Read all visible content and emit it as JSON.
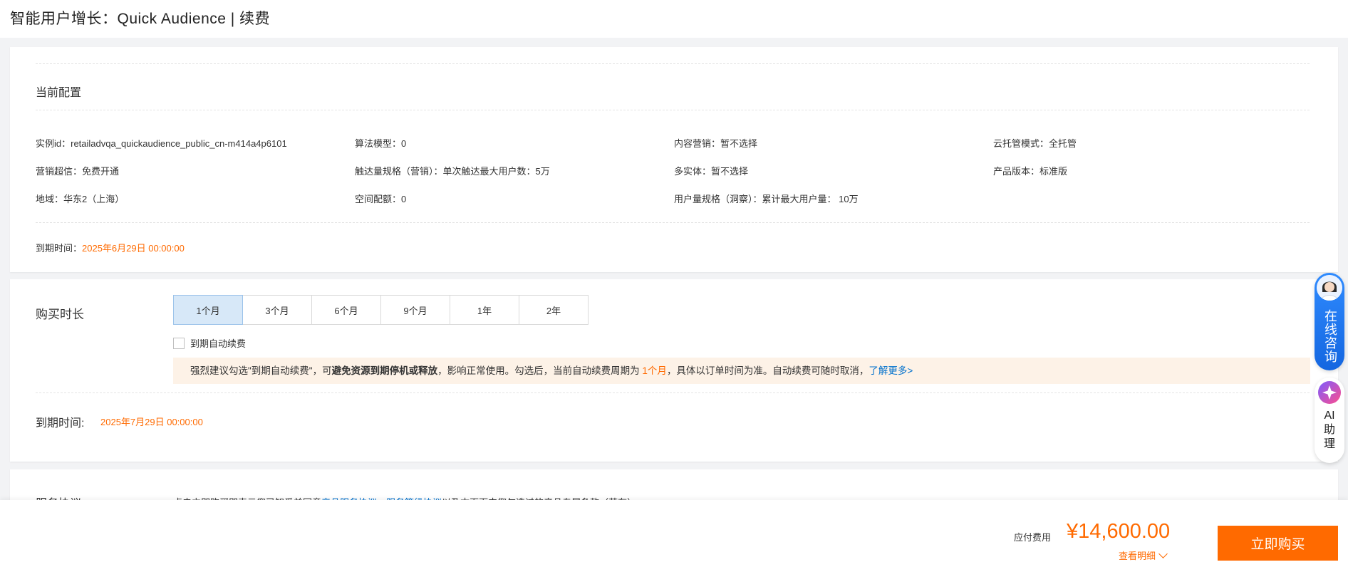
{
  "header": {
    "title": "智能用户增长：Quick Audience | 续费"
  },
  "current_config": {
    "title": "当前配置",
    "items": [
      [
        "实例id：retailadvqa_quickaudience_public_cn-m414a4p6101",
        "算法模型：0",
        "内容营销：暂不选择",
        "云托管模式：全托管"
      ],
      [
        "营销超信：免费开通",
        "触达量规格（营销）：单次触达最大用户数：5万",
        "多实体：暂不选择",
        "产品版本：标准版"
      ],
      [
        "地域：华东2（上海）",
        "空间配额：0",
        "用户量规格（洞察）：累计最大用户量： 10万",
        ""
      ]
    ],
    "expire_label": "到期时间：",
    "expire_value": "2025年6月29日 00:00:00"
  },
  "purchase": {
    "duration_label": "购买时长",
    "durations": [
      "1个月",
      "3个月",
      "6个月",
      "9个月",
      "1年",
      "2年"
    ],
    "selected_duration": "1个月",
    "auto_renew": {
      "label": "到期自动续费",
      "checked": false
    },
    "tip": {
      "part1": "强烈建议勾选\"到期自动续费\"，可",
      "bold": "避免资源到期停机或释放",
      "part2": "，影响正常使用。勾选后，当前自动续费周期为",
      "period": "1个月",
      "part3": "，具体以订单时间为准。自动续费可随时取消，",
      "link": "了解更多>"
    },
    "expire_label": "到期时间:",
    "expire_value": "2025年7月29日 00:00:00"
  },
  "agreement": {
    "label": "服务协议",
    "text1": "点击立即购买即表示您已知悉并同意",
    "link1": "产品服务协议",
    "sep": "、",
    "link2": "服务等级协议",
    "text2": "以及本页面中您勾选过的产品专属条款（若有）"
  },
  "footer": {
    "fee_label": "应付费用",
    "fee_value": "¥14,600.00",
    "detail_link": "查看明细",
    "buy_button": "立即购买"
  },
  "floating": {
    "consult": "在线咨询",
    "ai": "AI助理"
  },
  "colors": {
    "accent": "#ff6a00",
    "link": "#0070cc",
    "selected": "#d7e8f8"
  }
}
